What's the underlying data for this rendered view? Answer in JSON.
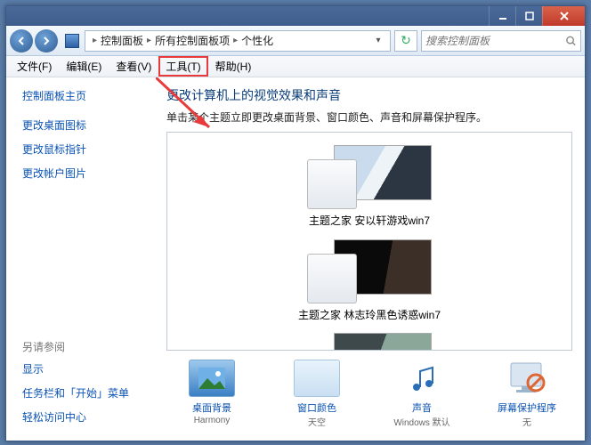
{
  "breadcrumb": {
    "root": "控制面板",
    "mid": "所有控制面板项",
    "leaf": "个性化"
  },
  "search": {
    "placeholder": "搜索控制面板"
  },
  "menubar": {
    "file": "文件(F)",
    "edit": "编辑(E)",
    "view": "查看(V)",
    "tools": "工具(T)",
    "help": "帮助(H)"
  },
  "sidebar": {
    "home": "控制面板主页",
    "links": [
      "更改桌面图标",
      "更改鼠标指针",
      "更改帐户图片"
    ],
    "see_also_title": "另请参阅",
    "see_also": [
      "显示",
      "任务栏和「开始」菜单",
      "轻松访问中心"
    ]
  },
  "main": {
    "heading": "更改计算机上的视觉效果和声音",
    "subheading": "单击某个主题立即更改桌面背景、窗口颜色、声音和屏幕保护程序。",
    "themes": [
      {
        "name": "主题之家 安以轩游戏win7"
      },
      {
        "name": "主题之家 林志玲黑色诱惑win7"
      },
      {
        "name": ""
      }
    ],
    "bottom": [
      {
        "label": "桌面背景",
        "value": "Harmony"
      },
      {
        "label": "窗口颜色",
        "value": "天空"
      },
      {
        "label": "声音",
        "value": "Windows 默认"
      },
      {
        "label": "屏幕保护程序",
        "value": "无"
      }
    ]
  }
}
